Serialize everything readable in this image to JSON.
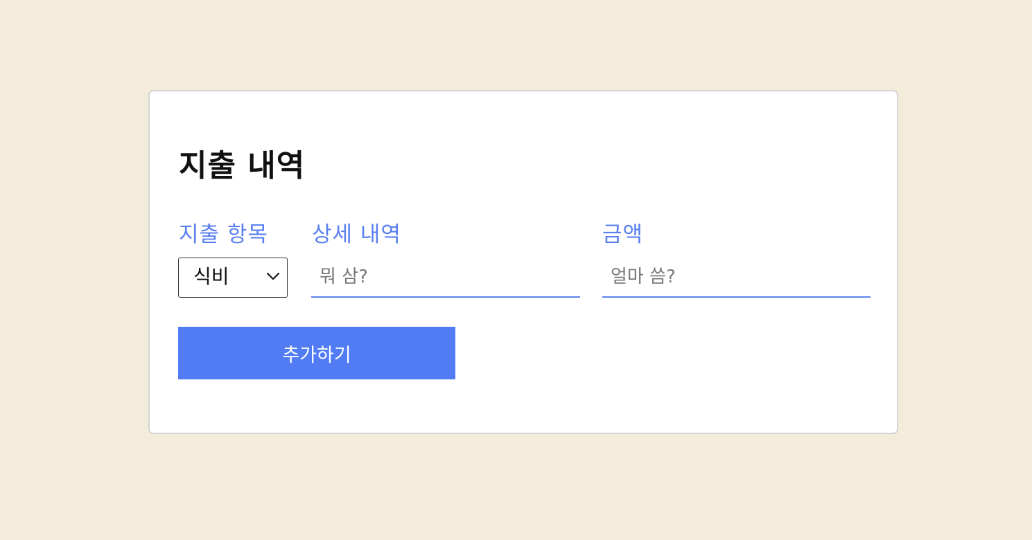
{
  "form": {
    "title": "지출 내역",
    "category": {
      "label": "지출 항목",
      "selected": "식비"
    },
    "detail": {
      "label": "상세 내역",
      "placeholder": "뭐 삼?",
      "value": ""
    },
    "amount": {
      "label": "금액",
      "placeholder": "얼마 씀?",
      "value": ""
    },
    "submit_label": "추가하기"
  },
  "colors": {
    "background": "#f4ecda",
    "card": "#ffffff",
    "accent": "#527cf4",
    "label": "#5a80f0"
  },
  "icons": {
    "select_arrow": "chevron-down-icon"
  }
}
